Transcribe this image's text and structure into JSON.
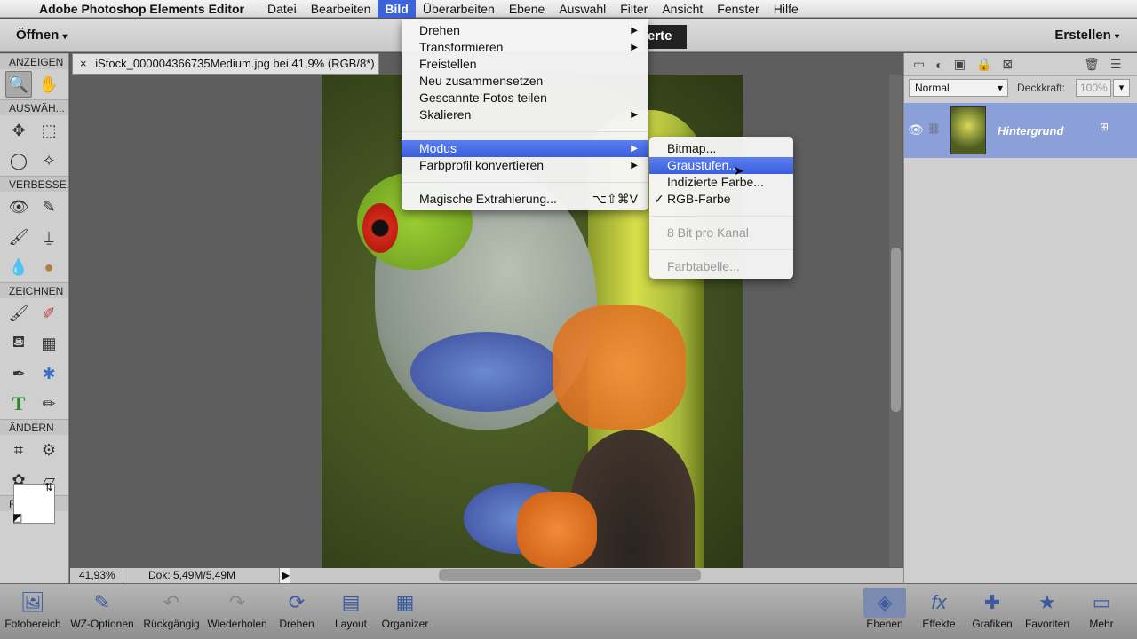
{
  "menubar": {
    "app": "Adobe Photoshop Elements Editor",
    "items": [
      "Datei",
      "Bearbeiten",
      "Bild",
      "Überarbeiten",
      "Ebene",
      "Auswahl",
      "Filter",
      "Ansicht",
      "Fenster",
      "Hilfe"
    ]
  },
  "optbar": {
    "open": "Öffnen",
    "create": "Erstellen",
    "quick_partial": "erte"
  },
  "toolbox": {
    "sections": [
      "ANZEIGEN",
      "AUSWÄH...",
      "VERBESSE...",
      "ZEICHNEN",
      "ÄNDERN",
      "FARBE"
    ]
  },
  "document": {
    "tab_title": "iStock_000004366735Medium.jpg bei 41,9% (RGB/8*)",
    "close": "×",
    "zoom": "41,93%",
    "doc_size": "Dok: 5,49M/5,49M"
  },
  "bild_menu": {
    "items": [
      {
        "label": "Drehen",
        "sub": "▶"
      },
      {
        "label": "Transformieren",
        "sub": "▶"
      },
      {
        "label": "Freistellen"
      },
      {
        "label": "Neu zusammensetzen"
      },
      {
        "label": "Gescannte Fotos teilen"
      },
      {
        "label": "Skalieren",
        "sub": "▶"
      },
      {
        "label": "Modus",
        "sub": "▶"
      },
      {
        "label": "Farbprofil konvertieren",
        "sub": "▶"
      },
      {
        "label": "Magische Extrahierung...",
        "shortcut": "⌥⇧⌘V"
      }
    ]
  },
  "modus_menu": {
    "items": [
      {
        "label": "Bitmap..."
      },
      {
        "label": "Graustufen..."
      },
      {
        "label": "Indizierte Farbe..."
      },
      {
        "label": "RGB-Farbe",
        "check": "✓"
      },
      {
        "label": "8 Bit pro Kanal"
      },
      {
        "label": "Farbtabelle..."
      }
    ]
  },
  "layers": {
    "blend_mode": "Normal",
    "opacity_label": "Deckkraft:",
    "opacity_value": "100%",
    "layer_name": "Hintergrund"
  },
  "bottombar": {
    "items": [
      "Fotobereich",
      "WZ-Optionen",
      "Rückgängig",
      "Wiederholen",
      "Drehen",
      "Layout",
      "Organizer",
      "Ebenen",
      "Effekte",
      "Grafiken",
      "Favoriten",
      "Mehr"
    ]
  }
}
